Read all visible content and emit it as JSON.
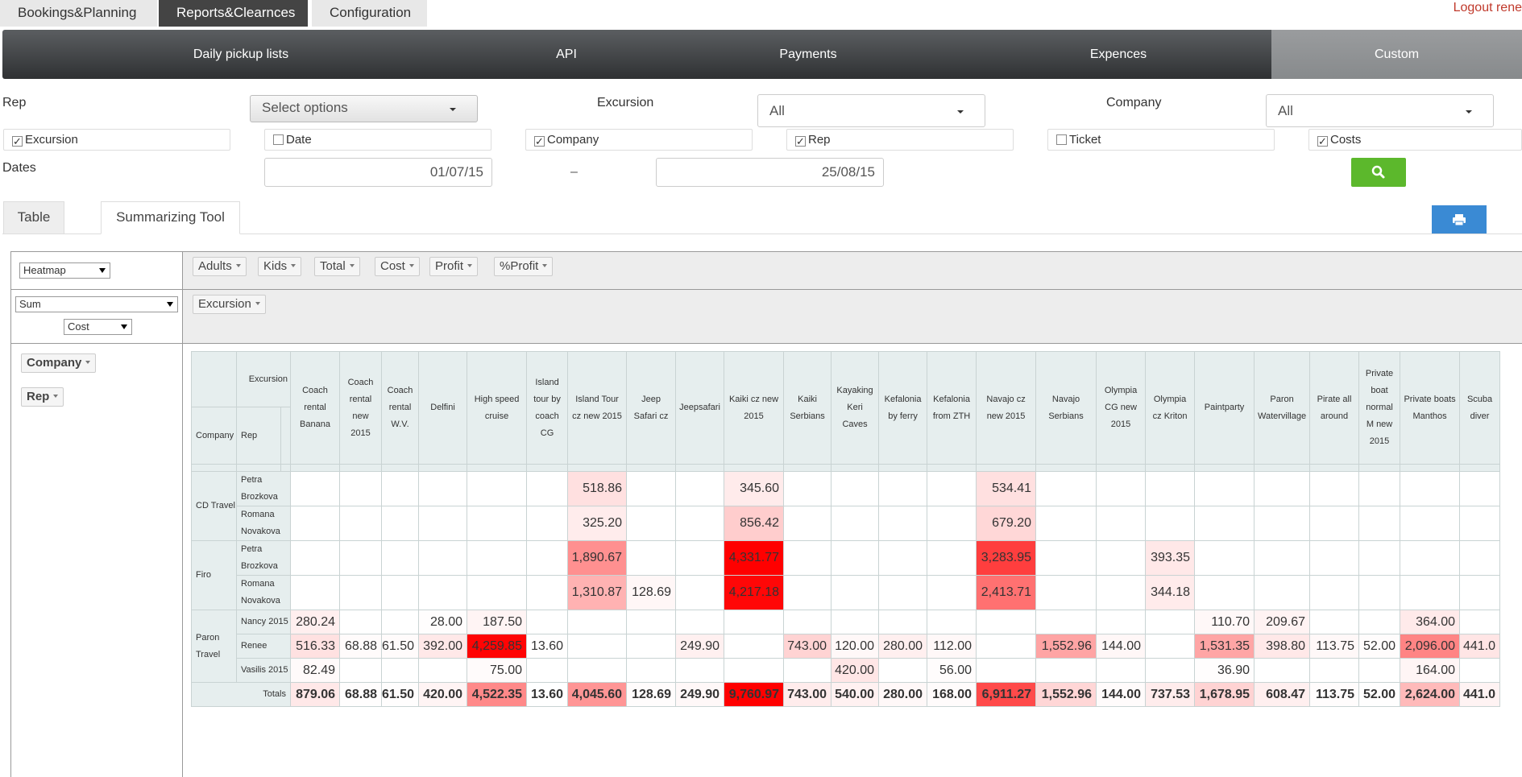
{
  "top_tabs": [
    "Bookings&Planning",
    "Reports&Clearnces",
    "Configuration"
  ],
  "logout": "Logout rene",
  "nav": [
    "Daily pickup lists",
    "API",
    "Payments",
    "Expences",
    "Custom"
  ],
  "filters": {
    "rep_label": "Rep",
    "rep_select": "Select options",
    "excursion_label": "Excursion",
    "excursion_select": "All",
    "company_label": "Company",
    "company_select": "All",
    "checks": [
      {
        "label": "Excursion",
        "checked": true
      },
      {
        "label": "Date",
        "checked": false
      },
      {
        "label": "Company",
        "checked": true
      },
      {
        "label": "Rep",
        "checked": true
      },
      {
        "label": "Ticket",
        "checked": false
      },
      {
        "label": "Costs",
        "checked": true
      }
    ],
    "dates_label": "Dates",
    "date_from": "01/07/15",
    "date_sep": "–",
    "date_to": "25/08/15"
  },
  "sub_tabs": [
    "Table",
    "Summarizing Tool"
  ],
  "pivot": {
    "renderer": "Heatmap",
    "aggregator": "Sum",
    "agg_field": "Cost",
    "unused_attrs": [
      "Adults",
      "Kids",
      "Total",
      "Cost",
      "Profit",
      "%Profit"
    ],
    "col_attrs": [
      "Excursion"
    ],
    "row_attrs": [
      "Company",
      "Rep"
    ],
    "table": {
      "corner_col": "Excursion",
      "corner_company": "Company",
      "corner_rep": "Rep",
      "columns": [
        "Coach rental Banana",
        "Coach rental new 2015",
        "Coach rental W.V.",
        "Delfini",
        "High speed cruise",
        "Island tour by coach CG",
        "Island Tour cz new 2015",
        "Jeep Safari cz",
        "Jeepsafari",
        "Kaiki cz new 2015",
        "Kaiki Serbians",
        "Kayaking Keri Caves",
        "Kefalonia by ferry",
        "Kefalonia from ZTH",
        "Navajo cz new 2015",
        "Navajo Serbians",
        "Olympia CG new 2015",
        "Olympia cz Kriton",
        "Paintparty",
        "Paron Watervillage",
        "Pirate all around",
        "Private boat normal M new 2015",
        "Private boats Manthos",
        "Scuba diver"
      ],
      "groups": [
        {
          "company": "CD Travel",
          "rows": [
            {
              "rep": "Petra Brozkova",
              "cells": [
                "",
                "",
                "",
                "",
                "",
                "",
                "518.86",
                "",
                "",
                "345.60",
                "",
                "",
                "",
                "",
                "534.41",
                "",
                "",
                "",
                "",
                "",
                "",
                "",
                "",
                ""
              ]
            },
            {
              "rep": "Romana Novakova",
              "cells": [
                "",
                "",
                "",
                "",
                "",
                "",
                "325.20",
                "",
                "",
                "856.42",
                "",
                "",
                "",
                "",
                "679.20",
                "",
                "",
                "",
                "",
                "",
                "",
                "",
                "",
                ""
              ]
            }
          ]
        },
        {
          "company": "Firo",
          "rows": [
            {
              "rep": "Petra Brozkova",
              "cells": [
                "",
                "",
                "",
                "",
                "",
                "",
                "1,890.67",
                "",
                "",
                "4,331.77",
                "",
                "",
                "",
                "",
                "3,283.95",
                "",
                "",
                "393.35",
                "",
                "",
                "",
                "",
                "",
                ""
              ]
            },
            {
              "rep": "Romana Novakova",
              "cells": [
                "",
                "",
                "",
                "",
                "",
                "",
                "1,310.87",
                "128.69",
                "",
                "4,217.18",
                "",
                "",
                "",
                "",
                "2,413.71",
                "",
                "",
                "344.18",
                "",
                "",
                "",
                "",
                "",
                ""
              ]
            }
          ]
        },
        {
          "company": "Paron Travel",
          "rows": [
            {
              "rep": "Nancy 2015",
              "cells": [
                "280.24",
                "",
                "",
                "28.00",
                "187.50",
                "",
                "",
                "",
                "",
                "",
                "",
                "",
                "",
                "",
                "",
                "",
                "",
                "",
                "110.70",
                "209.67",
                "",
                "",
                "364.00",
                ""
              ]
            },
            {
              "rep": "Renee",
              "cells": [
                "516.33",
                "68.88",
                "61.50",
                "392.00",
                "4,259.85",
                "13.60",
                "",
                "",
                "249.90",
                "",
                "743.00",
                "120.00",
                "280.00",
                "112.00",
                "",
                "1,552.96",
                "144.00",
                "",
                "1,531.35",
                "398.80",
                "113.75",
                "52.00",
                "2,096.00",
                "441.0"
              ]
            },
            {
              "rep": "Vasilis 2015",
              "cells": [
                "82.49",
                "",
                "",
                "",
                "75.00",
                "",
                "",
                "",
                "",
                "",
                "",
                "420.00",
                "",
                "56.00",
                "",
                "",
                "",
                "",
                "36.90",
                "",
                "",
                "",
                "164.00",
                ""
              ]
            }
          ]
        }
      ],
      "totals_label": "Totals",
      "totals": [
        "879.06",
        "68.88",
        "61.50",
        "420.00",
        "4,522.35",
        "13.60",
        "4,045.60",
        "128.69",
        "249.90",
        "9,760.97",
        "743.00",
        "540.00",
        "280.00",
        "168.00",
        "6,911.27",
        "1,552.96",
        "144.00",
        "737.53",
        "1,678.95",
        "608.47",
        "113.75",
        "52.00",
        "2,624.00",
        "441.0"
      ]
    }
  },
  "colors": {
    "heat_max": "#ff0000",
    "header_bg": "#e6eeee",
    "search_green": "#5cb82c",
    "print_blue": "#3a8ad4"
  }
}
